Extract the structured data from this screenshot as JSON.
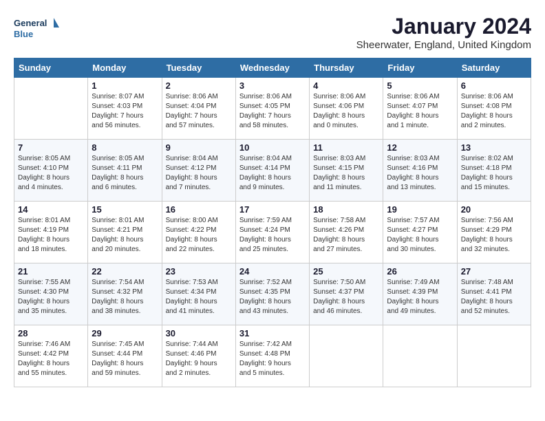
{
  "header": {
    "logo_line1": "General",
    "logo_line2": "Blue",
    "month": "January 2024",
    "location": "Sheerwater, England, United Kingdom"
  },
  "days_of_week": [
    "Sunday",
    "Monday",
    "Tuesday",
    "Wednesday",
    "Thursday",
    "Friday",
    "Saturday"
  ],
  "weeks": [
    [
      {
        "num": "",
        "info": ""
      },
      {
        "num": "1",
        "info": "Sunrise: 8:07 AM\nSunset: 4:03 PM\nDaylight: 7 hours\nand 56 minutes."
      },
      {
        "num": "2",
        "info": "Sunrise: 8:06 AM\nSunset: 4:04 PM\nDaylight: 7 hours\nand 57 minutes."
      },
      {
        "num": "3",
        "info": "Sunrise: 8:06 AM\nSunset: 4:05 PM\nDaylight: 7 hours\nand 58 minutes."
      },
      {
        "num": "4",
        "info": "Sunrise: 8:06 AM\nSunset: 4:06 PM\nDaylight: 8 hours\nand 0 minutes."
      },
      {
        "num": "5",
        "info": "Sunrise: 8:06 AM\nSunset: 4:07 PM\nDaylight: 8 hours\nand 1 minute."
      },
      {
        "num": "6",
        "info": "Sunrise: 8:06 AM\nSunset: 4:08 PM\nDaylight: 8 hours\nand 2 minutes."
      }
    ],
    [
      {
        "num": "7",
        "info": "Sunrise: 8:05 AM\nSunset: 4:10 PM\nDaylight: 8 hours\nand 4 minutes."
      },
      {
        "num": "8",
        "info": "Sunrise: 8:05 AM\nSunset: 4:11 PM\nDaylight: 8 hours\nand 6 minutes."
      },
      {
        "num": "9",
        "info": "Sunrise: 8:04 AM\nSunset: 4:12 PM\nDaylight: 8 hours\nand 7 minutes."
      },
      {
        "num": "10",
        "info": "Sunrise: 8:04 AM\nSunset: 4:14 PM\nDaylight: 8 hours\nand 9 minutes."
      },
      {
        "num": "11",
        "info": "Sunrise: 8:03 AM\nSunset: 4:15 PM\nDaylight: 8 hours\nand 11 minutes."
      },
      {
        "num": "12",
        "info": "Sunrise: 8:03 AM\nSunset: 4:16 PM\nDaylight: 8 hours\nand 13 minutes."
      },
      {
        "num": "13",
        "info": "Sunrise: 8:02 AM\nSunset: 4:18 PM\nDaylight: 8 hours\nand 15 minutes."
      }
    ],
    [
      {
        "num": "14",
        "info": "Sunrise: 8:01 AM\nSunset: 4:19 PM\nDaylight: 8 hours\nand 18 minutes."
      },
      {
        "num": "15",
        "info": "Sunrise: 8:01 AM\nSunset: 4:21 PM\nDaylight: 8 hours\nand 20 minutes."
      },
      {
        "num": "16",
        "info": "Sunrise: 8:00 AM\nSunset: 4:22 PM\nDaylight: 8 hours\nand 22 minutes."
      },
      {
        "num": "17",
        "info": "Sunrise: 7:59 AM\nSunset: 4:24 PM\nDaylight: 8 hours\nand 25 minutes."
      },
      {
        "num": "18",
        "info": "Sunrise: 7:58 AM\nSunset: 4:26 PM\nDaylight: 8 hours\nand 27 minutes."
      },
      {
        "num": "19",
        "info": "Sunrise: 7:57 AM\nSunset: 4:27 PM\nDaylight: 8 hours\nand 30 minutes."
      },
      {
        "num": "20",
        "info": "Sunrise: 7:56 AM\nSunset: 4:29 PM\nDaylight: 8 hours\nand 32 minutes."
      }
    ],
    [
      {
        "num": "21",
        "info": "Sunrise: 7:55 AM\nSunset: 4:30 PM\nDaylight: 8 hours\nand 35 minutes."
      },
      {
        "num": "22",
        "info": "Sunrise: 7:54 AM\nSunset: 4:32 PM\nDaylight: 8 hours\nand 38 minutes."
      },
      {
        "num": "23",
        "info": "Sunrise: 7:53 AM\nSunset: 4:34 PM\nDaylight: 8 hours\nand 41 minutes."
      },
      {
        "num": "24",
        "info": "Sunrise: 7:52 AM\nSunset: 4:35 PM\nDaylight: 8 hours\nand 43 minutes."
      },
      {
        "num": "25",
        "info": "Sunrise: 7:50 AM\nSunset: 4:37 PM\nDaylight: 8 hours\nand 46 minutes."
      },
      {
        "num": "26",
        "info": "Sunrise: 7:49 AM\nSunset: 4:39 PM\nDaylight: 8 hours\nand 49 minutes."
      },
      {
        "num": "27",
        "info": "Sunrise: 7:48 AM\nSunset: 4:41 PM\nDaylight: 8 hours\nand 52 minutes."
      }
    ],
    [
      {
        "num": "28",
        "info": "Sunrise: 7:46 AM\nSunset: 4:42 PM\nDaylight: 8 hours\nand 55 minutes."
      },
      {
        "num": "29",
        "info": "Sunrise: 7:45 AM\nSunset: 4:44 PM\nDaylight: 8 hours\nand 59 minutes."
      },
      {
        "num": "30",
        "info": "Sunrise: 7:44 AM\nSunset: 4:46 PM\nDaylight: 9 hours\nand 2 minutes."
      },
      {
        "num": "31",
        "info": "Sunrise: 7:42 AM\nSunset: 4:48 PM\nDaylight: 9 hours\nand 5 minutes."
      },
      {
        "num": "",
        "info": ""
      },
      {
        "num": "",
        "info": ""
      },
      {
        "num": "",
        "info": ""
      }
    ]
  ]
}
